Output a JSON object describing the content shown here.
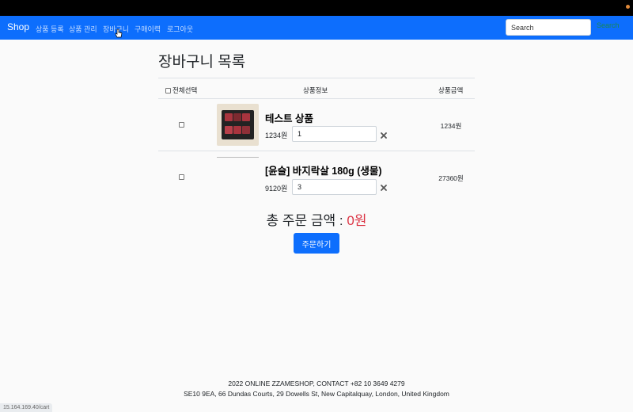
{
  "navbar": {
    "brand": "Shop",
    "links": [
      {
        "label": "상품 등록"
      },
      {
        "label": "상품 관리"
      },
      {
        "label": "장바구니"
      },
      {
        "label": "구매이력"
      },
      {
        "label": "로그아웃"
      }
    ],
    "search_placeholder": "Search",
    "search_button": "Search"
  },
  "page": {
    "title": "장바구니 목록"
  },
  "table": {
    "headers": {
      "select_all": "전체선택",
      "product_info": "상품정보",
      "amount": "상품금액"
    },
    "items": [
      {
        "name": "테스트 상품",
        "unit_price": "1234원",
        "quantity": "1",
        "amount": "1234원"
      },
      {
        "name": "[윤슬] 바지락살 180g (생물)",
        "unit_price": "9120원",
        "quantity": "3",
        "amount": "27360원"
      }
    ]
  },
  "total": {
    "label": "총 주문 금액 : ",
    "value": "0원"
  },
  "order_button": "주문하기",
  "footer": {
    "line1": "2022 ONLINE ZZAMESHOP, CONTACT +82 10 3649 4279",
    "line2": "SE10 9EA, 66 Dundas Courts, 29 Dowells St, New Capitalquay, London, United Kingdom"
  },
  "status_url": "15.164.169.40/cart",
  "colors": {
    "navbar": "#0d6efd",
    "total_value": "#dc3545",
    "search_button": "#198754"
  }
}
